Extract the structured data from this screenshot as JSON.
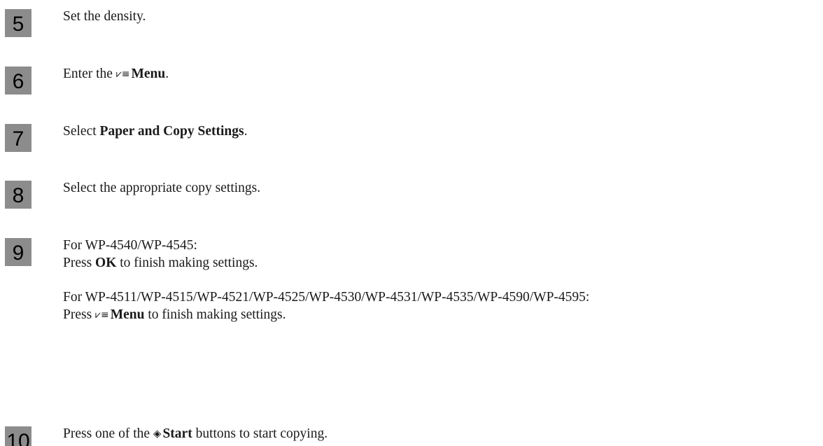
{
  "steps": [
    {
      "number": "5",
      "text": "Set the density."
    },
    {
      "number": "6",
      "prefix": "Enter the ",
      "icon": "menu-icon",
      "icon_glyph": "⩗≡",
      "bold": "Menu",
      "suffix": "."
    },
    {
      "number": "7",
      "prefix": "Select ",
      "bold": "Paper and Copy Settings",
      "suffix": "."
    },
    {
      "number": "8",
      "text": "Select the appropriate copy settings."
    },
    {
      "number": "9",
      "line1": "For WP-4540/WP-4545:",
      "line2_prefix": "Press ",
      "line2_bold": "OK",
      "line2_suffix": " to finish making settings.",
      "line3": "For WP-4511/WP-4515/WP-4521/WP-4525/WP-4530/WP-4531/WP-4535/WP-4590/WP-4595:",
      "line4_prefix": "Press ",
      "line4_icon": "menu-icon",
      "line4_icon_glyph": "⩗≡",
      "line4_bold": "Menu",
      "line4_suffix": " to finish making settings."
    },
    {
      "number": "10",
      "prefix": "Press one of the ",
      "icon": "start-icon",
      "icon_glyph": "◈",
      "bold": "Start",
      "suffix": " buttons to start copying."
    }
  ]
}
